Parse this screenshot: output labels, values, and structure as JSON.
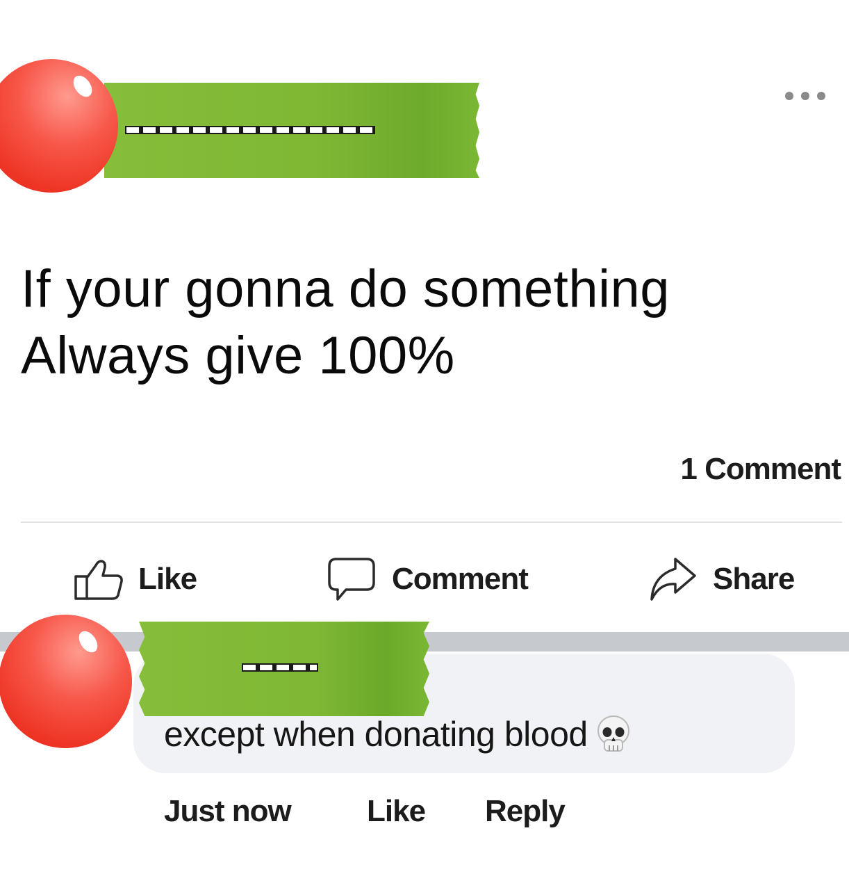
{
  "post": {
    "more_icon": "more-horizontal-icon",
    "text_line1": "If your gonna do something",
    "text_line2": "Always give 100%",
    "comment_count": "1 Comment"
  },
  "actions": {
    "like_label": "Like",
    "comment_label": "Comment",
    "share_label": "Share",
    "like_icon": "thumbs-up-icon",
    "comment_icon": "speech-bubble-icon",
    "share_icon": "share-arrow-icon"
  },
  "comment": {
    "text": "except when donating blood",
    "emoji": "skull",
    "time": "Just now",
    "like_label": "Like",
    "reply_label": "Reply"
  },
  "colors": {
    "avatar": "#ee3424",
    "redaction": "#7fb834",
    "bubble": "#f0f2f5",
    "grey_band": "#c6c9ce"
  }
}
